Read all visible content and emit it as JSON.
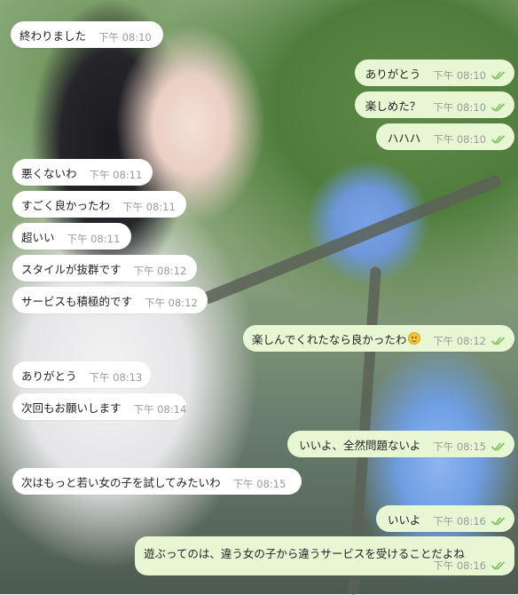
{
  "colors": {
    "incoming_bubble": "#ffffff",
    "outgoing_bubble": "#e7f7d3",
    "timestamp": "#9a9a9a",
    "read_ticks": "#7fbf5a"
  },
  "messages": [
    {
      "side": "in",
      "text": "終わりました",
      "time": "下午 08:10"
    },
    {
      "side": "out",
      "text": "ありがとう",
      "time": "下午 08:10",
      "read": true
    },
    {
      "side": "out",
      "text": "楽しめた？",
      "time": "下午 08:10",
      "read": true
    },
    {
      "side": "out",
      "text": "ハハハ",
      "time": "下午 08:10",
      "read": true
    },
    {
      "side": "in",
      "text": "悪くないわ",
      "time": "下午 08:11"
    },
    {
      "side": "in",
      "text": "すごく良かったわ",
      "time": "下午 08:11"
    },
    {
      "side": "in",
      "text": "超いい",
      "time": "下午 08:11"
    },
    {
      "side": "in",
      "text": "スタイルが抜群です",
      "time": "下午 08:12"
    },
    {
      "side": "in",
      "text": "サービスも積極的です",
      "time": "下午 08:12"
    },
    {
      "side": "out",
      "text": "楽しんでくれたなら良かったわ",
      "emoji": "smiling-face-emoji",
      "time": "下午 08:12",
      "read": true
    },
    {
      "side": "in",
      "text": "ありがとう",
      "time": "下午 08:13"
    },
    {
      "side": "in",
      "text": "次回もお願いします",
      "time": "下午 08:14"
    },
    {
      "side": "out",
      "text": "いいよ、全然問題ないよ",
      "time": "下午 08:15",
      "read": true
    },
    {
      "side": "in",
      "text": "次はもっと若い女の子を試してみたいわ",
      "time": "下午 08:15"
    },
    {
      "side": "out",
      "text": "いいよ",
      "time": "下午 08:16",
      "read": true
    },
    {
      "side": "out",
      "text": "遊ぶってのは、違う女の子から違うサービスを受けることだよね",
      "time": "下午 08:16",
      "read": true
    }
  ]
}
